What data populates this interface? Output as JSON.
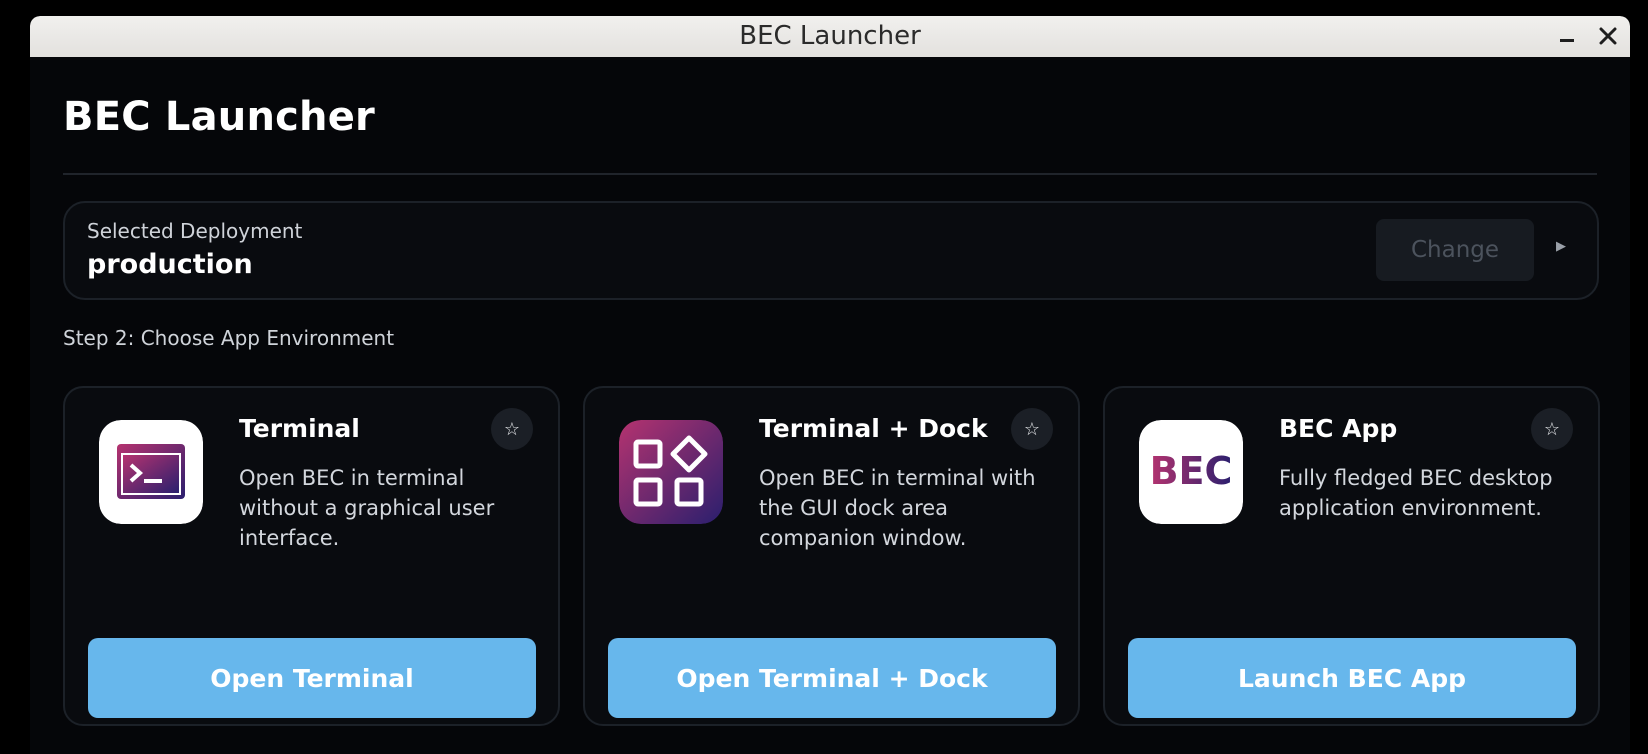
{
  "window": {
    "title": "BEC Launcher"
  },
  "app": {
    "title": "BEC Launcher"
  },
  "deployment": {
    "label": "Selected Deployment",
    "value": "production",
    "change_label": "Change"
  },
  "step": {
    "label": "Step 2: Choose App Environment"
  },
  "cards": [
    {
      "title": "Terminal",
      "description": "Open BEC in terminal without a graphical user interface.",
      "button_label": "Open Terminal",
      "icon": "terminal-icon"
    },
    {
      "title": "Terminal + Dock",
      "description": "Open BEC in terminal with the GUI dock area companion window.",
      "button_label": "Open Terminal + Dock",
      "icon": "dock-area-icon"
    },
    {
      "title": "BEC App",
      "description": "Fully fledged BEC desktop application environment.",
      "button_label": "Launch BEC App",
      "icon": "bec-logo-icon",
      "logo_text": "BEC"
    }
  ],
  "colors": {
    "accent_button": "#67b7ec",
    "window_background": "#050609",
    "icon_gradient_start": "#b5336f",
    "icon_gradient_end": "#2a1f6e"
  }
}
